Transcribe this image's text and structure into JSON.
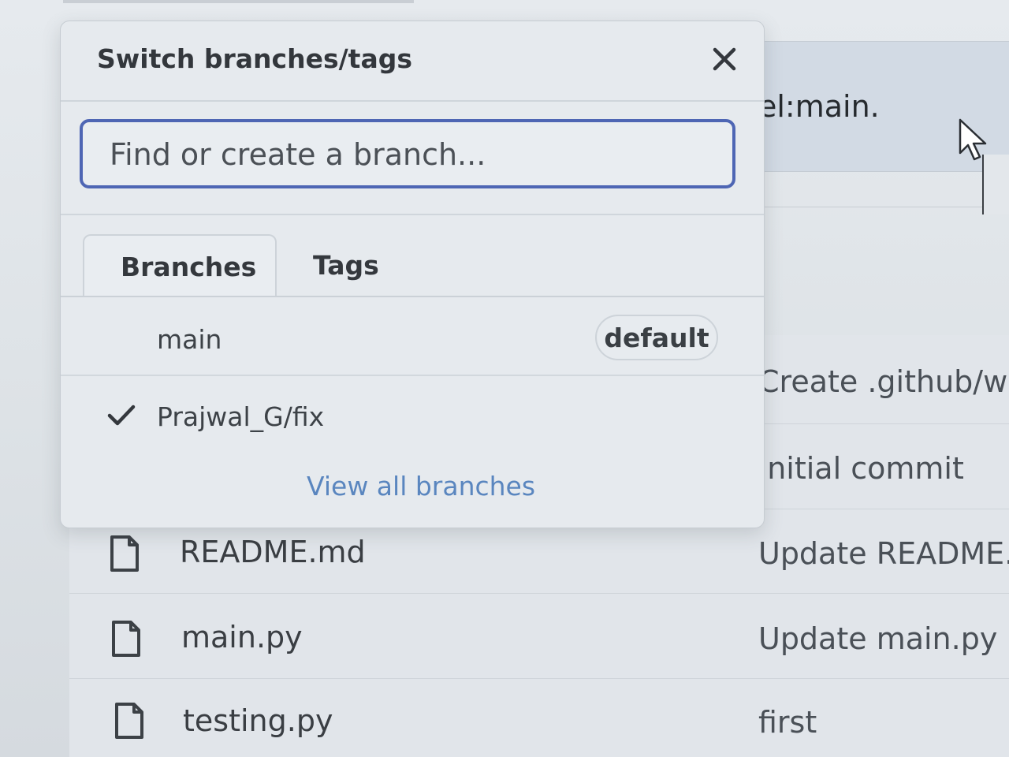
{
  "background": {
    "banner_text": "el:main.",
    "files": [
      {
        "name": "README.md",
        "icon": "file-icon",
        "commit": "Update README.r"
      },
      {
        "name": "main.py",
        "icon": "file-icon",
        "commit": "Update main.py"
      },
      {
        "name": "testing.py",
        "icon": "file-icon",
        "commit": "first"
      }
    ],
    "commit_messages_above": [
      "Create .github/wo",
      "Initial commit"
    ]
  },
  "dropdown": {
    "title": "Switch branches/tags",
    "search_placeholder": "Find or create a branch...",
    "tabs": [
      {
        "label": "Branches",
        "selected": true
      },
      {
        "label": "Tags",
        "selected": false
      }
    ],
    "branches": [
      {
        "name": "main",
        "badge": "default",
        "checked": false
      },
      {
        "name": "Prajwal_G/fix",
        "badge": "",
        "checked": true
      }
    ],
    "view_all_label": "View all branches"
  },
  "colors": {
    "accent": "#4e66b4",
    "link": "#5a86bf"
  }
}
